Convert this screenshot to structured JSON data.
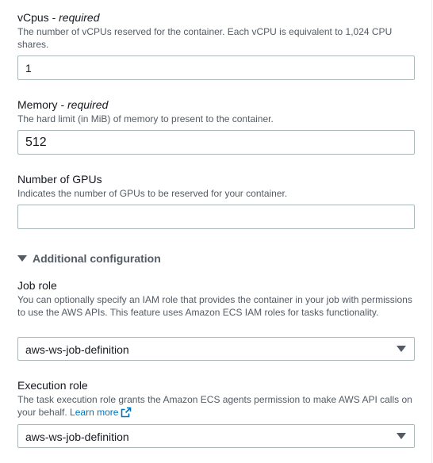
{
  "vcpus": {
    "label": "vCpus - ",
    "required": "required",
    "description": "The number of vCPUs reserved for the container. Each vCPU is equivalent to 1,024 CPU shares.",
    "value": "1"
  },
  "memory": {
    "label": "Memory - ",
    "required": "required",
    "description": "The hard limit (in MiB) of memory to present to the container.",
    "value": "512"
  },
  "gpus": {
    "label": "Number of GPUs",
    "description": "Indicates the number of GPUs to be reserved for your container.",
    "value": ""
  },
  "additional_config": {
    "label": "Additional configuration",
    "expanded": true
  },
  "job_role": {
    "label": "Job role",
    "description": "You can optionally specify an IAM role that provides the container in your job with permissions to use the AWS APIs. This feature uses Amazon ECS IAM roles for tasks functionality.",
    "selected": "aws-ws-job-definition"
  },
  "execution_role": {
    "label": "Execution role",
    "description": "The task execution role grants the Amazon ECS agents permission to make AWS API calls on your behalf. ",
    "learn_more": "Learn more",
    "selected": "aws-ws-job-definition"
  },
  "icons": {
    "caret": "caret-down-icon",
    "external_link": "external-link-icon",
    "expand": "expand-triangle-icon"
  },
  "colors": {
    "link": "#0073bb",
    "text": "#16191f",
    "description": "#545b64",
    "border": "#aab7b8"
  }
}
